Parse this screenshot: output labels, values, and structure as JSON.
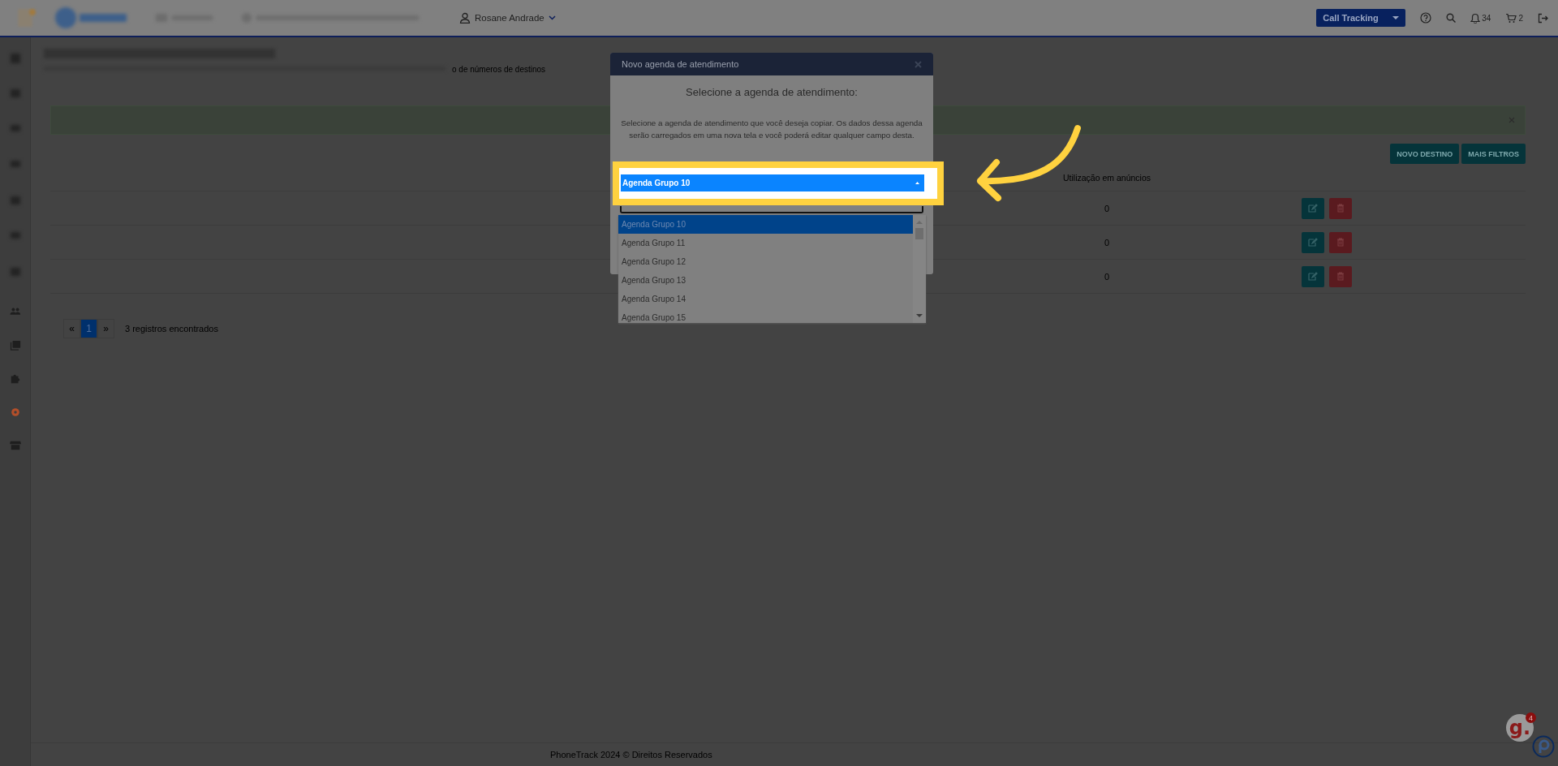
{
  "topbar": {
    "user": "Rosane Andrade",
    "product_select": "Call Tracking",
    "notifications": "34",
    "cart": "2"
  },
  "breadcrumb_tail": "o de números de destinos",
  "toolbar": {
    "buttons": [
      "NOVO DESTINO",
      "MAIS FILTROS"
    ]
  },
  "table": {
    "columns": [
      {
        "label": "Utilização em anúncios"
      }
    ],
    "rows": [
      {
        "usage": "0"
      },
      {
        "usage": "0"
      },
      {
        "usage": "0"
      }
    ]
  },
  "pagination": {
    "prev": "«",
    "pages": [
      {
        "label": "1",
        "selected": true
      }
    ],
    "next": "»",
    "summary": "3 registros encontrados"
  },
  "modal": {
    "title": "Novo agenda de atendimento",
    "heading": "Selecione a agenda de atendimento:",
    "description": "Selecione a agenda de atendimento que você deseja copiar. Os dados dessa agenda serão carregados em uma nova tela e você poderá editar qualquer campo desta.",
    "select_value": "Agenda Grupo 10",
    "options": [
      {
        "label": "Agenda Grupo 10",
        "selected": true
      },
      {
        "label": "Agenda Grupo 11",
        "selected": false
      },
      {
        "label": "Agenda Grupo 12",
        "selected": false
      },
      {
        "label": "Agenda Grupo 13",
        "selected": false
      },
      {
        "label": "Agenda Grupo 14",
        "selected": false
      },
      {
        "label": "Agenda Grupo 15",
        "selected": false
      }
    ]
  },
  "footer": "PhoneTrack 2024 © Direitos Reservados",
  "chat_badge": {
    "logo": "g.",
    "count": "4"
  }
}
